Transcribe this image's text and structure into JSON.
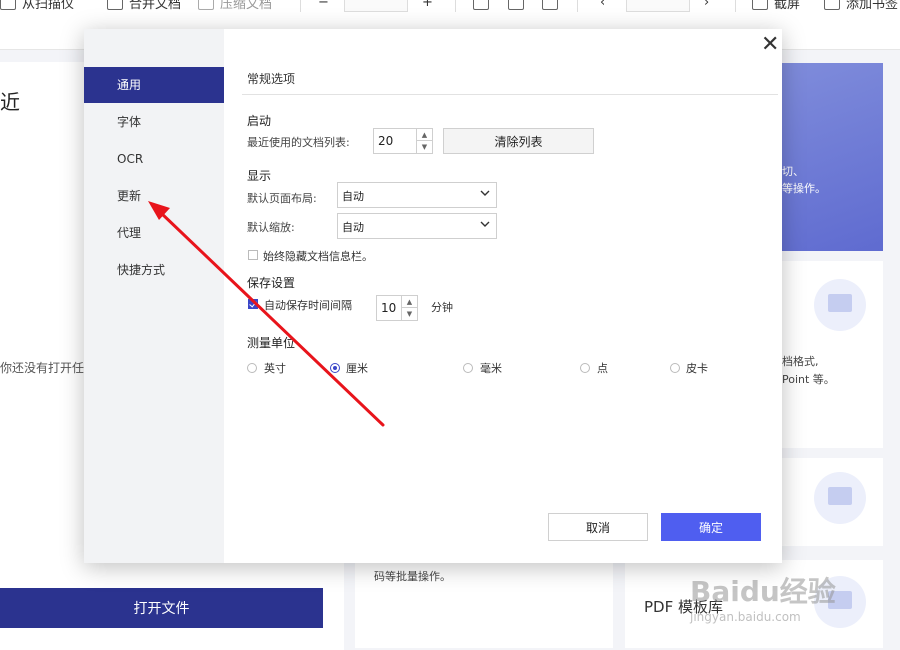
{
  "toolbar": {
    "scan_label": "从扫描仪",
    "merge_label": "合并文档",
    "compress_label": "压缩文档",
    "screenshot_label": "截屏",
    "bookmark_label": "添加书签"
  },
  "background": {
    "recent_title": "近",
    "no_file_text": "你还没有打开任",
    "open_file_button": "打开文件",
    "blue_card": {
      "line1": "切、",
      "line2": "等操作。"
    },
    "convert_card": {
      "line1": "档格式,",
      "line2": "Point 等。"
    },
    "batch_card": {
      "line1": "码等批量操作。"
    },
    "template_card": {
      "title": "PDF 模板库"
    },
    "watermark": "Baidu经验",
    "watermark_url": "jingyan.baidu.com"
  },
  "dialog": {
    "sidebar": [
      {
        "label": "通用",
        "active": true
      },
      {
        "label": "字体",
        "active": false
      },
      {
        "label": "OCR",
        "active": false
      },
      {
        "label": "更新",
        "active": false
      },
      {
        "label": "代理",
        "active": false
      },
      {
        "label": "快捷方式",
        "active": false
      }
    ],
    "section_title": "常规选项",
    "startup": {
      "heading": "启动",
      "recent_list_label": "最近使用的文档列表:",
      "recent_list_value": "20",
      "clear_list_button": "清除列表"
    },
    "display": {
      "heading": "显示",
      "page_layout_label": "默认页面布局:",
      "page_layout_value": "自动",
      "zoom_label": "默认缩放:",
      "zoom_value": "自动",
      "hide_info_bar_label": "始终隐藏文档信息栏。",
      "hide_info_bar_checked": false
    },
    "save": {
      "heading": "保存设置",
      "autosave_label": "自动保存时间间隔",
      "autosave_checked": true,
      "autosave_value": "10",
      "autosave_unit": "分钟"
    },
    "units": {
      "heading": "测量单位",
      "options": [
        "英寸",
        "厘米",
        "毫米",
        "点",
        "皮卡"
      ],
      "selected": "厘米"
    },
    "cancel_button": "取消",
    "ok_button": "确定"
  },
  "colors": {
    "sidebar_active": "#2b338f",
    "ok_button": "#4f5ef0",
    "annotation_arrow": "#e8141b"
  },
  "icons": {
    "close": "close-icon",
    "dropdown": "chevron-down-icon",
    "spin_up": "chevron-up-icon",
    "spin_down": "chevron-down-icon"
  }
}
